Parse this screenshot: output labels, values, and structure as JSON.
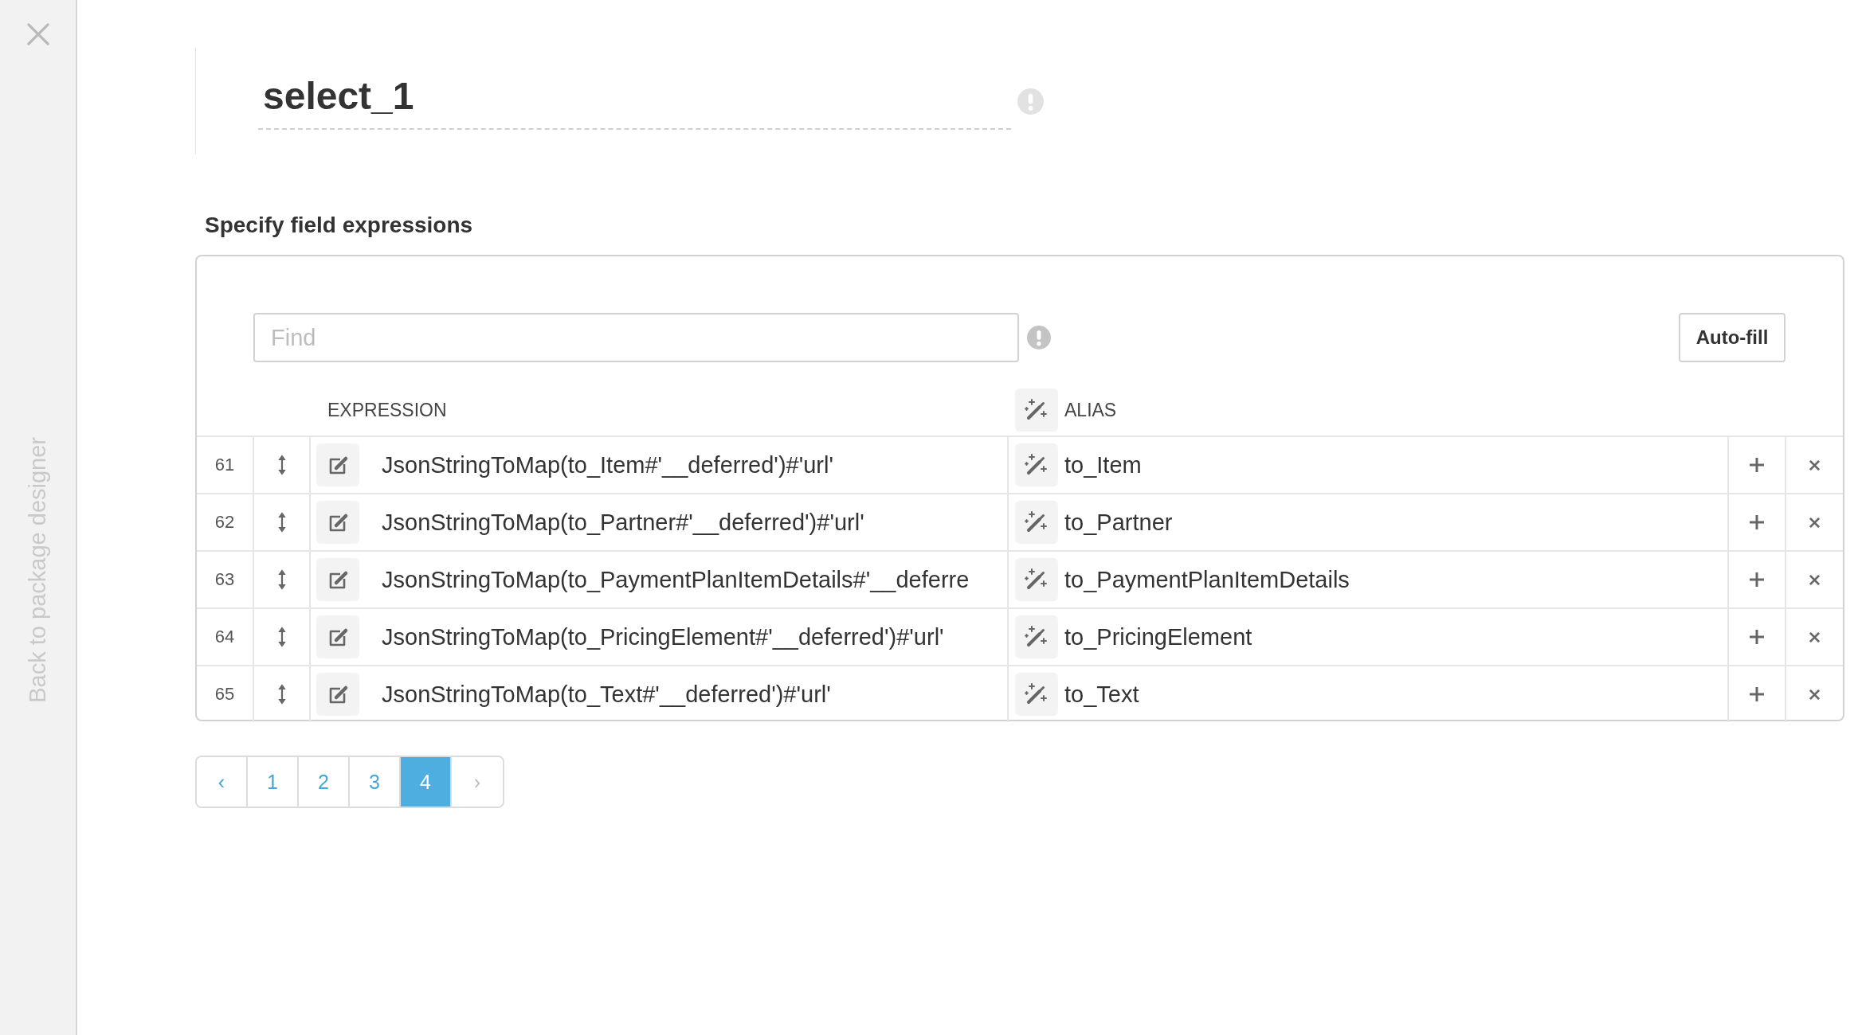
{
  "sidebar": {
    "link": "Back to package designer"
  },
  "name_field": {
    "value": "select_1"
  },
  "section_title": "Specify field expressions",
  "find": {
    "placeholder": "Find"
  },
  "autofill_button": "Auto-fill",
  "table": {
    "columns": [
      "EXPRESSION",
      "ALIAS"
    ],
    "rows": [
      {
        "number": "61",
        "expression": "JsonStringToMap(to_Item#'__deferred')#'url'",
        "alias": "to_Item"
      },
      {
        "number": "62",
        "expression": "JsonStringToMap(to_Partner#'__deferred')#'url'",
        "alias": "to_Partner"
      },
      {
        "number": "63",
        "expression": "JsonStringToMap(to_PaymentPlanItemDetails#'__deferre",
        "alias": "to_PaymentPlanItemDetails"
      },
      {
        "number": "64",
        "expression": "JsonStringToMap(to_PricingElement#'__deferred')#'url'",
        "alias": "to_PricingElement"
      },
      {
        "number": "65",
        "expression": "JsonStringToMap(to_Text#'__deferred')#'url'",
        "alias": "to_Text"
      }
    ]
  },
  "pagination": {
    "prev": {
      "label": "‹",
      "disabled": false
    },
    "pages": [
      {
        "label": "1",
        "selected": false
      },
      {
        "label": "2",
        "selected": false
      },
      {
        "label": "3",
        "selected": false
      },
      {
        "label": "4",
        "selected": true
      }
    ],
    "next": {
      "label": "›",
      "disabled": true
    }
  }
}
